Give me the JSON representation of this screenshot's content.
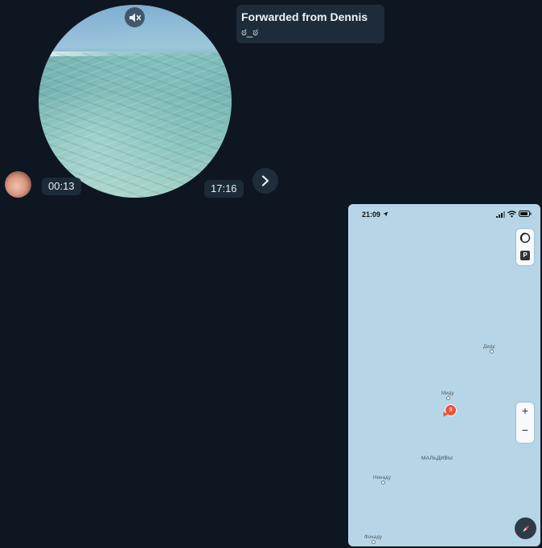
{
  "message": {
    "video_duration": "00:13",
    "time": "17:16"
  },
  "forward": {
    "title": "Forwarded from Dennis",
    "text": "ಠ_ಠ"
  },
  "map_screenshot": {
    "status_time": "21:09",
    "places": {
      "didu": "Диду",
      "midu": "Миду",
      "maldives": "МАЛЬДИВЫ",
      "ninadu": "Нинаду",
      "fonadu": "Фонаду"
    },
    "pin_badge": "9",
    "zoom_in": "+",
    "zoom_out": "−",
    "parking_label": "P"
  },
  "colors": {
    "background": "#0e1621",
    "bubble": "#1e2c3a",
    "map_water": "#b6d6e7",
    "pin": "#e8543a"
  }
}
